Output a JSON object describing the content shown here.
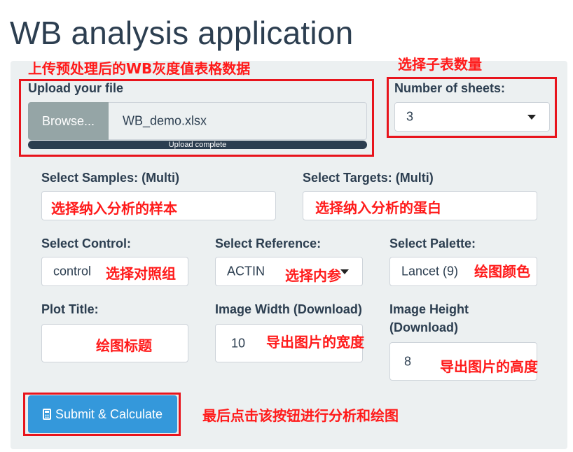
{
  "app": {
    "title": "WB analysis application"
  },
  "upload": {
    "label": "Upload your file",
    "browse_label": "Browse...",
    "filename": "WB_demo.xlsx",
    "progress_text": "Upload complete",
    "progress": 1.0,
    "annotation": "上传预处理后的WB灰度值表格数据"
  },
  "sheets": {
    "label": "Number of sheets:",
    "value": "3",
    "annotation": "选择子表数量"
  },
  "samples": {
    "label": "Select Samples: (Multi)",
    "annotation": "选择纳入分析的样本"
  },
  "targets": {
    "label": "Select Targets: (Multi)",
    "annotation": "选择纳入分析的蛋白"
  },
  "control": {
    "label": "Select Control:",
    "value": "control",
    "annotation": "选择对照组"
  },
  "reference": {
    "label": "Select Reference:",
    "value": "ACTIN",
    "annotation": "选择内参"
  },
  "palette": {
    "label": "Select Palette:",
    "value": "Lancet (9)",
    "annotation": "绘图颜色"
  },
  "plot_title": {
    "label": "Plot Title:",
    "value": "",
    "annotation": "绘图标题"
  },
  "image_width": {
    "label": "Image Width (Download)",
    "value": "10",
    "annotation": "导出图片的宽度"
  },
  "image_height": {
    "label_line1": "Image Height",
    "label_line2": "(Download)",
    "value": "8",
    "annotation": "导出图片的高度"
  },
  "submit": {
    "label": "Submit & Calculate",
    "icon": "calculator-icon",
    "annotation": "最后点击该按钮进行分析和绘图"
  },
  "colors": {
    "annotation": "#ff1a1a",
    "button": "#3498db",
    "panel": "#ecf0f1"
  }
}
